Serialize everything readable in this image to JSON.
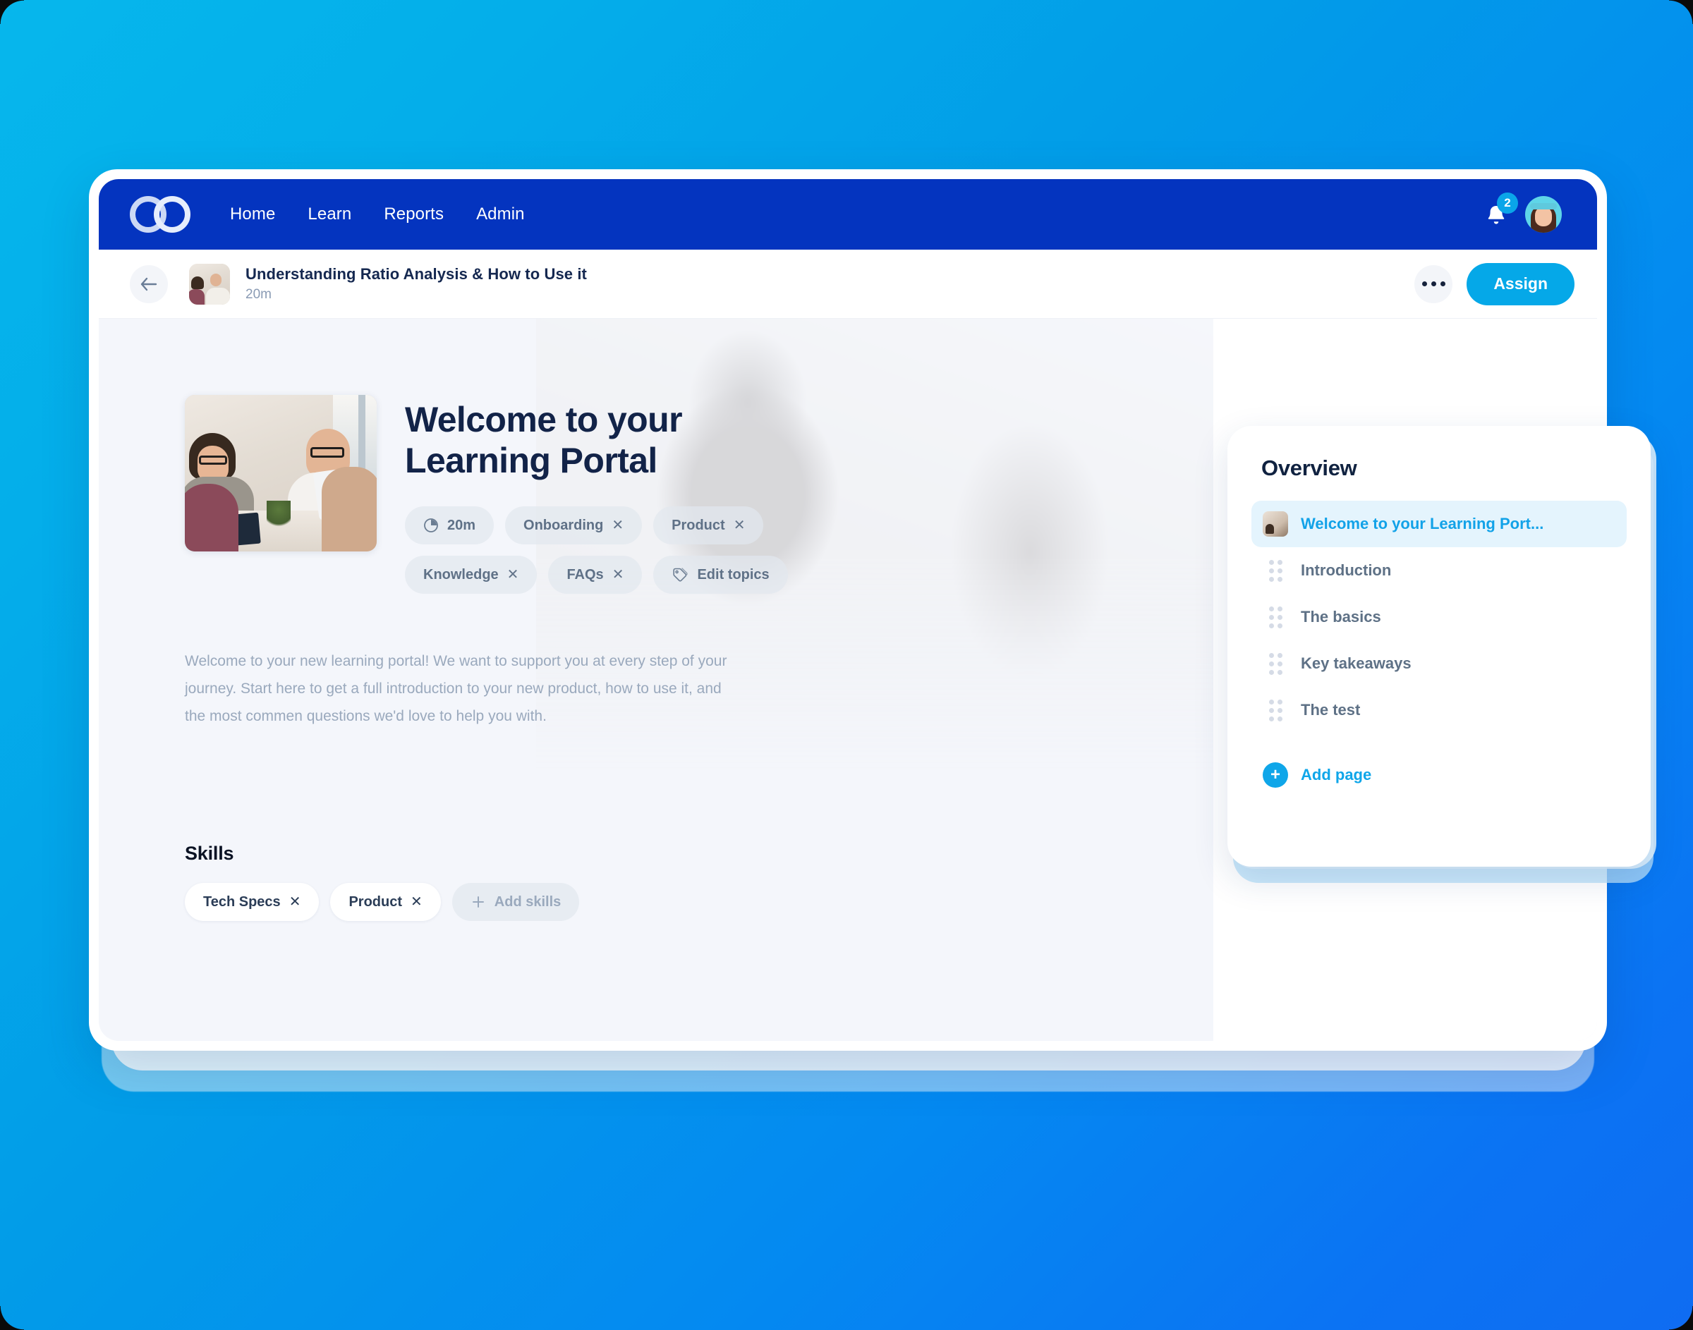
{
  "brand": {
    "logo_name": "infinity-loop-logo",
    "nav_bg": "#0434bf",
    "accent": "#05a8e8",
    "page_gradient_from": "#06b7ec",
    "page_gradient_to": "#0f6cf2"
  },
  "topnav": {
    "links": [
      {
        "label": "Home"
      },
      {
        "label": "Learn"
      },
      {
        "label": "Reports"
      },
      {
        "label": "Admin"
      }
    ],
    "notifications": {
      "icon": "bell-icon",
      "count": "2"
    },
    "avatar_alt": "user-avatar"
  },
  "subheader": {
    "back_icon": "arrow-left-icon",
    "thumbnail_alt": "course-thumbnail",
    "title": "Understanding Ratio Analysis & How to Use it",
    "duration": "20m",
    "more_icon": "ellipsis-icon",
    "assign_label": "Assign"
  },
  "hero": {
    "image_alt": "team-meeting-photo",
    "title_line1": "Welcome to your",
    "title_line2": "Learning Portal",
    "chips": [
      {
        "label": "20m",
        "icon": "clock-icon",
        "removable": false
      },
      {
        "label": "Onboarding",
        "icon": "",
        "removable": true
      },
      {
        "label": "Product",
        "icon": "",
        "removable": true
      },
      {
        "label": "Knowledge",
        "icon": "",
        "removable": true
      },
      {
        "label": "FAQs",
        "icon": "",
        "removable": true
      },
      {
        "label": "Edit topics",
        "icon": "tag-icon",
        "removable": false
      }
    ],
    "description": "Welcome to your new learning portal! We want to support you at every step of your journey. Start here to get a full introduction to your new product, how to use it, and the most commen questions we'd love to help you with."
  },
  "skills": {
    "heading": "Skills",
    "items": [
      {
        "label": "Tech Specs",
        "style": "white",
        "removable": true
      },
      {
        "label": "Product",
        "style": "white",
        "removable": true
      }
    ],
    "add_label": "Add skills",
    "add_icon": "plus-icon"
  },
  "overview": {
    "heading": "Overview",
    "pages": [
      {
        "label": "Welcome to your Learning Port...",
        "active": true,
        "leading": "thumbnail"
      },
      {
        "label": "Introduction",
        "active": false,
        "leading": "drag-handle"
      },
      {
        "label": "The basics",
        "active": false,
        "leading": "drag-handle"
      },
      {
        "label": "Key takeaways",
        "active": false,
        "leading": "drag-handle"
      },
      {
        "label": "The test",
        "active": false,
        "leading": "drag-handle"
      }
    ],
    "add_page_label": "Add page",
    "add_page_icon": "plus-circle-icon"
  }
}
